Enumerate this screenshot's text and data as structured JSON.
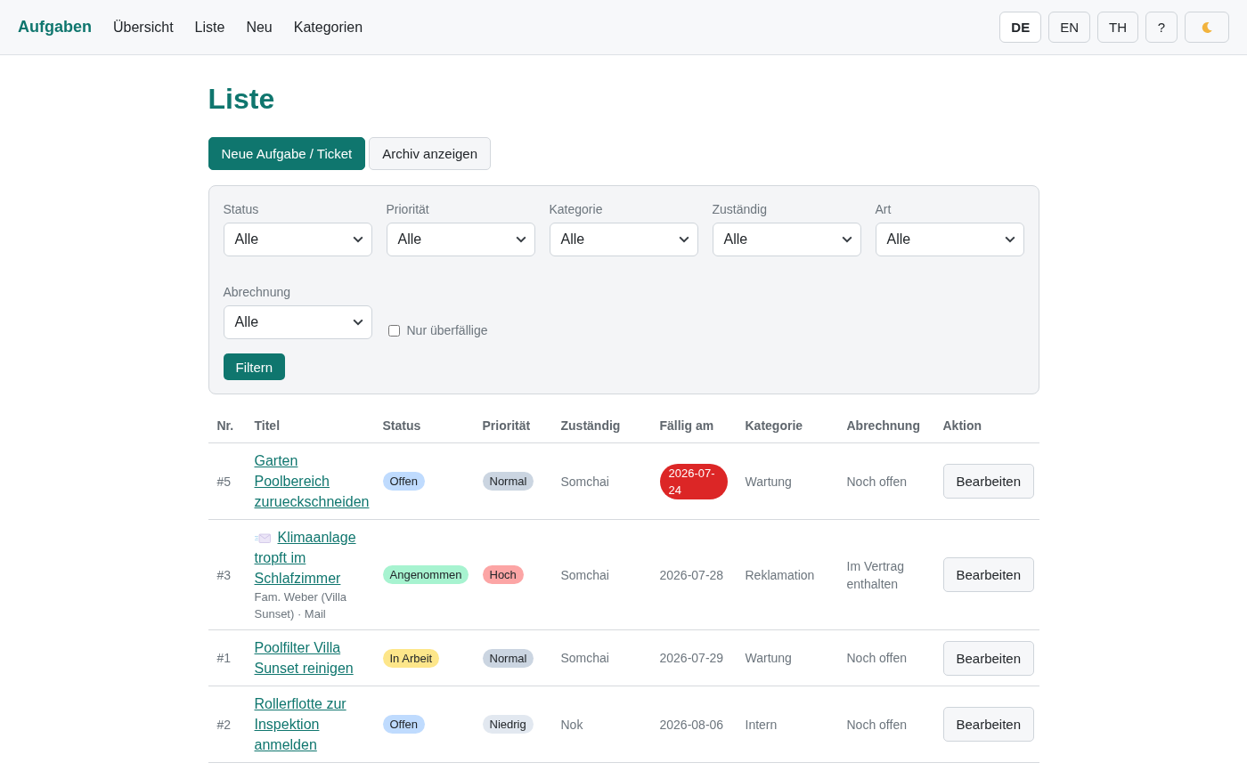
{
  "navbar": {
    "brand": "Aufgaben",
    "links": [
      "Übersicht",
      "Liste",
      "Neu",
      "Kategorien"
    ],
    "languages": [
      {
        "label": "DE",
        "selected": true
      },
      {
        "label": "EN",
        "selected": false
      },
      {
        "label": "TH",
        "selected": false
      }
    ],
    "help_button": "?"
  },
  "page": {
    "title": "Liste",
    "actions": [
      {
        "label": "Neue Aufgabe / Ticket",
        "kind": "primary"
      },
      {
        "label": "Archiv anzeigen",
        "kind": "secondary"
      }
    ]
  },
  "filters": {
    "selects": [
      {
        "label": "Status",
        "value": "Alle"
      },
      {
        "label": "Priorität",
        "value": "Alle"
      },
      {
        "label": "Kategorie",
        "value": "Alle"
      },
      {
        "label": "Zuständig",
        "value": "Alle"
      },
      {
        "label": "Art",
        "value": "Alle"
      },
      {
        "label": "Abrechnung",
        "value": "Alle"
      }
    ],
    "overdue_only": {
      "label": "Nur überfällige",
      "checked": false
    },
    "submit": "Filtern"
  },
  "table": {
    "columns": [
      "Nr.",
      "Titel",
      "Status",
      "Priorität",
      "Zuständig",
      "Fällig am",
      "Kategorie",
      "Abrechnung",
      "Aktion"
    ],
    "rows": [
      {
        "nr": "#5",
        "title": "Garten Poolbereich zurueckschneiden",
        "mail_icon": false,
        "status": {
          "label": "Offen",
          "color": "#bfdbfe"
        },
        "priority": {
          "label": "Normal",
          "color": "#cbd5e1"
        },
        "assignee": "Somchai",
        "due": "2026-07-24",
        "overdue": true,
        "category": "Wartung",
        "billing": "Noch offen",
        "action": "Bearbeiten"
      },
      {
        "nr": "#3",
        "title": "Klimaanlage tropft im Schlafzimmer",
        "mail_icon": true,
        "subtitle": "Fam. Weber (Villa Sunset) · Mail",
        "status": {
          "label": "Angenommen",
          "color": "#a7f3d0"
        },
        "priority": {
          "label": "Hoch",
          "color": "#fca5a5"
        },
        "assignee": "Somchai",
        "due": "2026-07-28",
        "overdue": false,
        "category": "Reklamation",
        "billing": "Im Vertrag enthalten",
        "action": "Bearbeiten"
      },
      {
        "nr": "#1",
        "title": "Poolfilter Villa Sunset reinigen",
        "mail_icon": false,
        "status": {
          "label": "In Arbeit",
          "color": "#fde68a"
        },
        "priority": {
          "label": "Normal",
          "color": "#cbd5e1"
        },
        "assignee": "Somchai",
        "due": "2026-07-29",
        "overdue": false,
        "category": "Wartung",
        "billing": "Noch offen",
        "action": "Bearbeiten"
      },
      {
        "nr": "#2",
        "title": "Rollerflotte zur Inspektion anmelden",
        "mail_icon": false,
        "status": {
          "label": "Offen",
          "color": "#bfdbfe"
        },
        "priority": {
          "label": "Niedrig",
          "color": "#e2e8f0"
        },
        "assignee": "Nok",
        "due": "2026-08-06",
        "overdue": false,
        "category": "Intern",
        "billing": "Noch offen",
        "action": "Bearbeiten"
      }
    ]
  }
}
